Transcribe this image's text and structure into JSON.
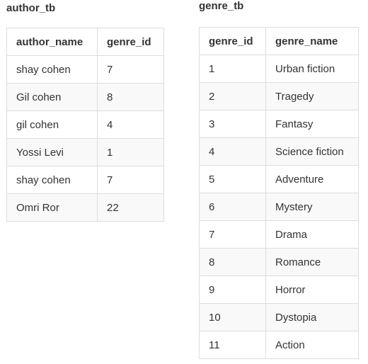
{
  "author_tb": {
    "title": "author_tb",
    "headers": [
      "author_name",
      "genre_id"
    ],
    "rows": [
      [
        "shay cohen",
        "7"
      ],
      [
        "Gil cohen",
        "8"
      ],
      [
        "gil cohen",
        "4"
      ],
      [
        "Yossi Levi",
        "1"
      ],
      [
        "shay cohen",
        "7"
      ],
      [
        "Omri Ror",
        "22"
      ]
    ]
  },
  "genre_tb": {
    "title": "genre_tb",
    "headers": [
      "genre_id",
      "genre_name"
    ],
    "rows": [
      [
        "1",
        "Urban fiction"
      ],
      [
        "2",
        "Tragedy"
      ],
      [
        "3",
        "Fantasy"
      ],
      [
        "4",
        "Science fiction"
      ],
      [
        "5",
        "Adventure"
      ],
      [
        "6",
        "Mystery"
      ],
      [
        "7",
        "Drama"
      ],
      [
        "8",
        "Romance"
      ],
      [
        "9",
        "Horror"
      ],
      [
        "10",
        "Dystopia"
      ],
      [
        "11",
        "Action"
      ]
    ]
  }
}
